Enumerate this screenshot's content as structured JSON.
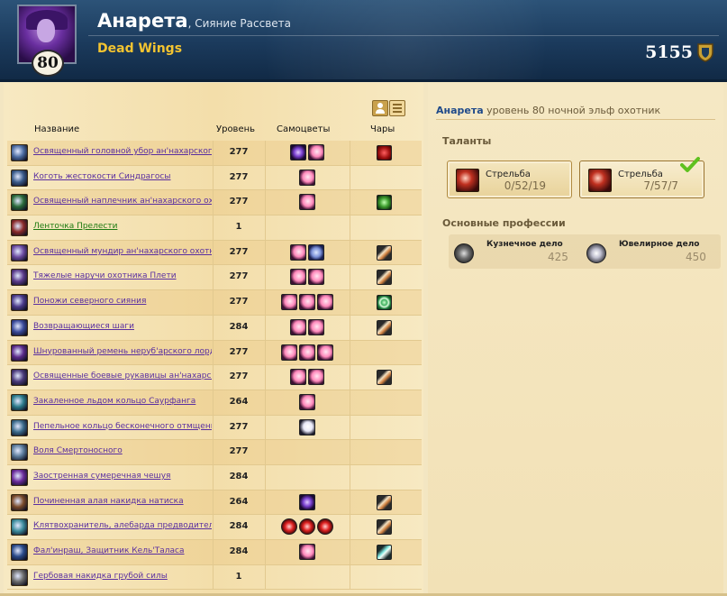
{
  "header": {
    "level": "80",
    "character_name": "Анарета",
    "realm": ", Сияние Рассвета",
    "guild": "Dead Wings",
    "achievement_points": "5155",
    "colors": {
      "banner": "#1b3a5c",
      "guild": "#f4c430"
    }
  },
  "equipment": {
    "columns": {
      "name": "Название",
      "level": "Уровень",
      "gems": "Самоцветы",
      "enchants": "Чары"
    },
    "items": [
      {
        "name": "Освященный головной убор ан'нахарского охотника",
        "level": "277",
        "gems": [
          "purple",
          "pink"
        ],
        "enchant": "red"
      },
      {
        "name": "Коготь жестокости Синдрагосы",
        "level": "277",
        "gems": [
          "pink"
        ],
        "enchant": null
      },
      {
        "name": "Освященный наплечник ан'нахарского охотника",
        "level": "277",
        "gems": [
          "pink"
        ],
        "enchant": "green"
      },
      {
        "name": "Ленточка Прелести",
        "level": "1",
        "gems": [],
        "enchant": null,
        "color": "green"
      },
      {
        "name": "Освященный мундир ан'нахарского охотника",
        "level": "277",
        "gems": [
          "pink",
          "blue"
        ],
        "enchant": "scroll"
      },
      {
        "name": "Тяжелые наручи охотника Плети",
        "level": "277",
        "gems": [
          "pink",
          "pink"
        ],
        "enchant": "scroll"
      },
      {
        "name": "Поножи северного сияния",
        "level": "277",
        "gems": [
          "pink",
          "pink",
          "pink"
        ],
        "enchant": "spiral"
      },
      {
        "name": "Возвращающиеся шаги",
        "level": "284",
        "gems": [
          "pink",
          "pink"
        ],
        "enchant": "scroll"
      },
      {
        "name": "Шнурованный ремень неруб'арского лорда",
        "level": "277",
        "gems": [
          "pink",
          "pink",
          "pink"
        ],
        "enchant": null
      },
      {
        "name": "Освященные боевые рукавицы ан'нахарского охотника",
        "level": "277",
        "gems": [
          "pink",
          "pink"
        ],
        "enchant": "scroll"
      },
      {
        "name": "Закаленное льдом кольцо Саурфанга",
        "level": "264",
        "gems": [
          "pink"
        ],
        "enchant": null
      },
      {
        "name": "Пепельное кольцо бесконечного отмщения",
        "level": "277",
        "gems": [
          "white"
        ],
        "enchant": null
      },
      {
        "name": "Воля Смертоносного",
        "level": "277",
        "gems": [],
        "enchant": null
      },
      {
        "name": "Заостренная сумеречная чешуя",
        "level": "284",
        "gems": [],
        "enchant": null
      },
      {
        "name": "Починенная алая накидка натиска",
        "level": "264",
        "gems": [
          "purple"
        ],
        "enchant": "scroll"
      },
      {
        "name": "Клятвохранитель, алебарда предводителя",
        "level": "284",
        "gems": [
          "red",
          "red",
          "red"
        ],
        "enchant": "scroll"
      },
      {
        "name": "Фал'инраш, Защитник Кель'Таласа",
        "level": "284",
        "gems": [
          "pink"
        ],
        "enchant": "cyan"
      },
      {
        "name": "Гербовая накидка грубой силы",
        "level": "1",
        "gems": [],
        "enchant": null
      }
    ]
  },
  "summary": {
    "name": "Анарета",
    "rest": " уровень 80 ночной эльф охотник",
    "talents_title": "Таланты",
    "talents": [
      {
        "name": "Стрельба",
        "points": "0/52/19",
        "active": false
      },
      {
        "name": "Стрельба",
        "points": "7/57/7",
        "active": true
      }
    ],
    "professions_title": "Основные профессии",
    "professions": [
      {
        "name": "Кузнечное дело",
        "value": "425",
        "icon": "blacksmithing-icon"
      },
      {
        "name": "Ювелирное дело",
        "value": "450",
        "icon": "jewelcrafting-icon"
      }
    ]
  }
}
